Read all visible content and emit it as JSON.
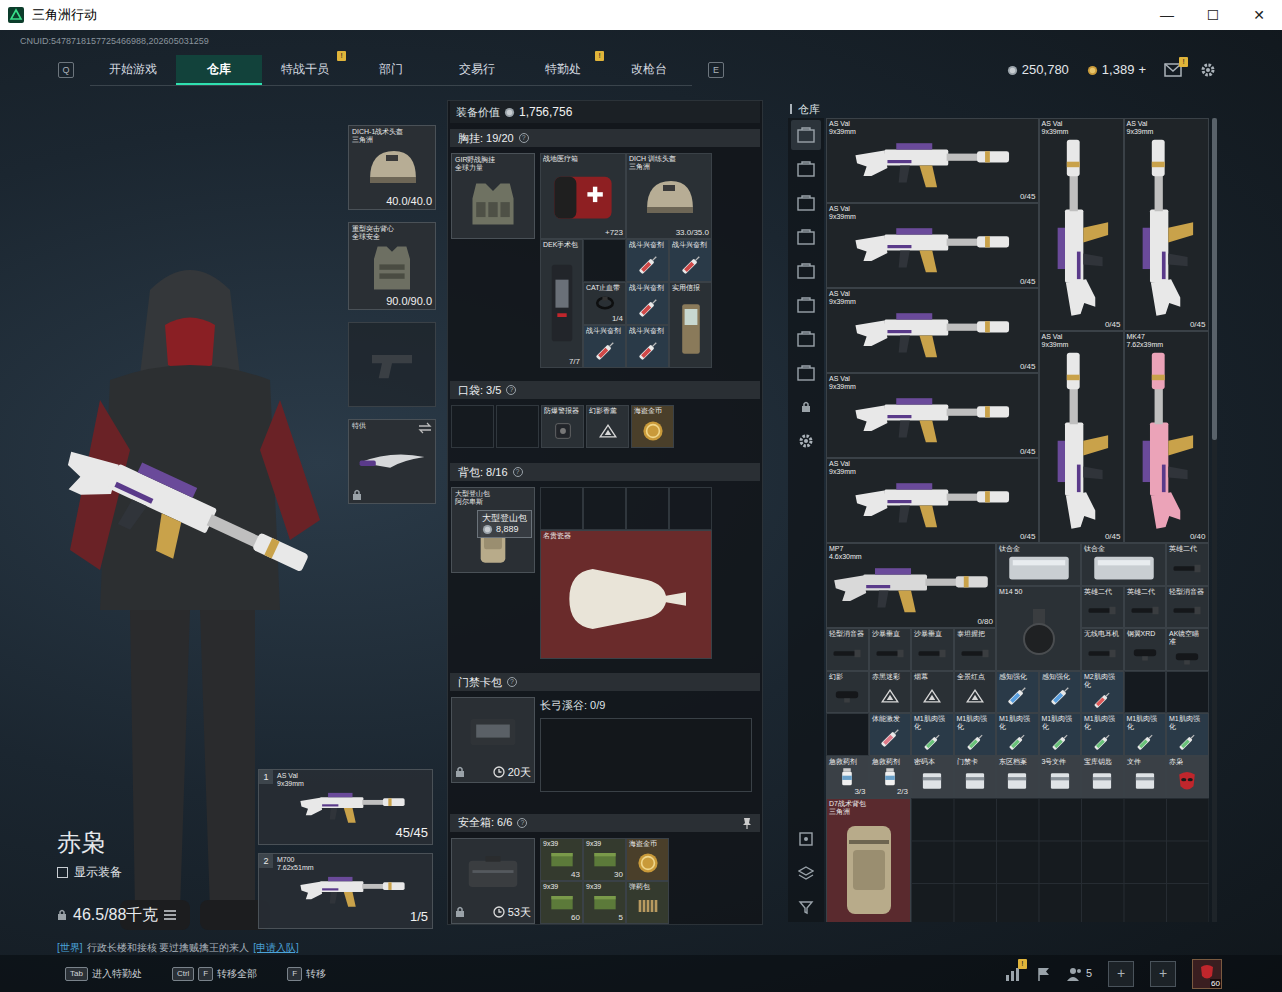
{
  "window": {
    "title": "三角洲行动",
    "controls": [
      "—",
      "☐",
      "✕"
    ]
  },
  "account": {
    "cnuid": "CNUID:5478718157725466988,202605031259"
  },
  "nav": {
    "prev_key": "Q",
    "next_key": "E",
    "tabs": [
      {
        "label": "开始游戏",
        "selected": false,
        "badge": ""
      },
      {
        "label": "仓库",
        "selected": true,
        "badge": ""
      },
      {
        "label": "特战干员",
        "selected": false,
        "badge": "!"
      },
      {
        "label": "部门",
        "selected": false,
        "badge": ""
      },
      {
        "label": "交易行",
        "selected": false,
        "badge": ""
      },
      {
        "label": "特勤处",
        "selected": false,
        "badge": "!"
      },
      {
        "label": "改枪台",
        "selected": false,
        "badge": ""
      }
    ]
  },
  "currency": {
    "silver": "250,780",
    "gold": "1,389",
    "add": "+",
    "mail_badge": "!"
  },
  "operator": {
    "name": "赤枭",
    "show_gear": {
      "label": "显示装备",
      "checked": false
    },
    "weight": "46.5/88千克",
    "chat": {
      "channel": "[世界]",
      "text": "行政长楼和接核 要过擒贼擒王的来人",
      "action": "[申请入队]"
    }
  },
  "equipment": {
    "helmet": {
      "name": "DICH-1战术头盔",
      "sub": "三角洲",
      "durability": "40.0/40.0"
    },
    "armor": {
      "name": "重型突击背心",
      "sub": "全球安全",
      "durability": "90.0/90.0"
    },
    "melee": {
      "name": "特供",
      "locked": true
    },
    "weapons": [
      {
        "slot": "1",
        "name": "AS Val",
        "caliber": "9x39mm",
        "ammo": "45/45"
      },
      {
        "slot": "2",
        "name": "M700",
        "caliber": "7.62x51mm",
        "ammo": "1/5"
      }
    ]
  },
  "loadout": {
    "value_label": "装备价值",
    "value": "1,756,756",
    "chest": {
      "title": "胸挂: 19/20",
      "help": "?",
      "rig": {
        "name": "GIR野战胸挂",
        "sub": "全球力量"
      },
      "items": [
        {
          "kind": "medkit",
          "label": "战地医疗箱",
          "count": "+723"
        },
        {
          "kind": "helmet",
          "label": "DICH 训练头盔",
          "sub": "三角洲",
          "count": "33.0/35.0"
        },
        {
          "kind": "surgery",
          "label": "DEK手术包",
          "count": "7/7"
        },
        {
          "kind": "empty"
        },
        {
          "kind": "syringe",
          "label": "战斗兴奋剂",
          "color": "#d04848"
        },
        {
          "kind": "syringe",
          "label": "战斗兴奋剂",
          "color": "#d04848"
        },
        {
          "kind": "tourniquet",
          "label": "CAT止血带",
          "count": "1/4"
        },
        {
          "kind": "syringe",
          "label": "战斗兴奋剂",
          "color": "#d04848"
        },
        {
          "kind": "device",
          "label": "实用信报"
        },
        {
          "kind": "syringe",
          "label": "战斗兴奋剂",
          "color": "#d04848"
        },
        {
          "kind": "syringe",
          "label": "战斗兴奋剂",
          "color": "#d04848"
        }
      ]
    },
    "pockets": {
      "title": "口袋: 3/5",
      "help": "?",
      "items": [
        {
          "kind": "empty"
        },
        {
          "kind": "empty"
        },
        {
          "kind": "gadget",
          "label": "防爆警报器"
        },
        {
          "kind": "triangle",
          "label": "幻影香薰"
        },
        {
          "kind": "coin",
          "label": "海盗金币"
        }
      ]
    },
    "backpack": {
      "title": "背包: 8/16",
      "help": "?",
      "bag": {
        "name": "大型登山包",
        "sub": "阿尔卑斯"
      },
      "tooltip": {
        "name": "大型登山包",
        "value": "8,889"
      },
      "items": [
        {
          "kind": "empty"
        },
        {
          "kind": "empty"
        },
        {
          "kind": "empty"
        },
        {
          "kind": "empty"
        },
        {
          "kind": "vase",
          "label": "名贵瓷器"
        }
      ]
    },
    "keycard": {
      "title": "门禁卡包",
      "help": "?",
      "timer": "20天",
      "map": "长弓溪谷: 0/9"
    },
    "safe": {
      "title": "安全箱: 6/6",
      "help": "?",
      "timer": "53天",
      "items": [
        {
          "kind": "ammo",
          "label": "9x39",
          "count": "43"
        },
        {
          "kind": "ammo",
          "label": "9x39",
          "count": "30"
        },
        {
          "kind": "coin",
          "label": "海盗金币"
        },
        {
          "kind": "ammo",
          "label": "9x39",
          "count": "60"
        },
        {
          "kind": "ammo",
          "label": "9x39",
          "count": "5"
        },
        {
          "kind": "shells",
          "label": "弹药包"
        }
      ]
    }
  },
  "warehouse": {
    "title": "仓库",
    "sidebar": [
      {
        "selected": true
      },
      {
        "selected": false
      },
      {
        "selected": false
      },
      {
        "selected": false
      },
      {
        "selected": false
      },
      {
        "selected": false
      },
      {
        "selected": false
      },
      {
        "selected": false
      }
    ],
    "scrollbar": {
      "level": 0.4
    },
    "items": [
      {
        "kind": "rifle-h",
        "label": "AS Val",
        "sub": "9x39mm",
        "count": "0/45",
        "color": "#e8e8e8"
      },
      {
        "kind": "rifle-v",
        "label": "AS Val",
        "sub": "9x39mm",
        "count": "0/45",
        "color": "#e8e8e8"
      },
      {
        "kind": "rifle-v",
        "label": "AS Val",
        "sub": "9x39mm",
        "count": "0/45",
        "color": "#e8e8e8"
      },
      {
        "kind": "rifle-h",
        "label": "AS Val",
        "sub": "9x39mm",
        "count": "0/45",
        "color": "#e8e8e8"
      },
      {
        "kind": "rifle-h",
        "label": "AS Val",
        "sub": "9x39mm",
        "count": "0/45",
        "color": "#e8e8e8"
      },
      {
        "kind": "rifle-v",
        "label": "AS Val",
        "sub": "9x39mm",
        "count": "0/45",
        "color": "#e8e8e8"
      },
      {
        "kind": "rifle-v",
        "label": "MK47",
        "sub": "7.62x39mm",
        "count": "0/40",
        "color": "#eba3b8"
      },
      {
        "kind": "rifle-h",
        "label": "AS Val",
        "sub": "9x39mm",
        "count": "0/45",
        "color": "#e8e8e8"
      },
      {
        "kind": "rifle-h",
        "label": "AS Val",
        "sub": "9x39mm",
        "count": "0/45",
        "color": "#e8e8e8"
      },
      {
        "kind": "smg",
        "label": "MP7",
        "sub": "4.6x30mm",
        "count": "0/80",
        "color": "#d9d9d9"
      },
      {
        "kind": "plate",
        "label": "钛合金"
      },
      {
        "kind": "plate",
        "label": "钛合金"
      },
      {
        "kind": "attachment",
        "label": "英雄二代"
      },
      {
        "kind": "drum",
        "label": "M14 50"
      },
      {
        "kind": "attachment",
        "label": "英雄二代"
      },
      {
        "kind": "attachment",
        "label": "英雄二代"
      },
      {
        "kind": "attachment",
        "label": "轻型消音器"
      },
      {
        "kind": "attachment",
        "label": "轻型消音器"
      },
      {
        "kind": "attachment",
        "label": "沙暴垂直"
      },
      {
        "kind": "attachment",
        "label": "沙暴垂直"
      },
      {
        "kind": "attachment",
        "label": "泰坦握把"
      },
      {
        "kind": "attachment",
        "label": "无线电耳机"
      },
      {
        "kind": "scope",
        "label": "钢翼XRD"
      },
      {
        "kind": "scope",
        "label": "AK镜空瞄准"
      },
      {
        "kind": "scope",
        "label": "幻影"
      },
      {
        "kind": "triangle",
        "label": "赤黑迷彩"
      },
      {
        "kind": "triangle",
        "label": "烟幕"
      },
      {
        "kind": "triangle",
        "label": "全景红点"
      },
      {
        "kind": "syringe",
        "label": "感知强化",
        "color": "#5aa0e0"
      },
      {
        "kind": "syringe",
        "label": "感知强化",
        "color": "#5aa0e0"
      },
      {
        "kind": "syringe",
        "label": "M2肌肉强化",
        "color": "#e05a5a"
      },
      {
        "kind": "empty"
      },
      {
        "kind": "empty"
      },
      {
        "kind": "empty"
      },
      {
        "kind": "syringe",
        "label": "体能激发",
        "color": "#e07a8a"
      },
      {
        "kind": "syringe",
        "label": "M1肌肉强化",
        "color": "#6ac27a"
      },
      {
        "kind": "syringe",
        "label": "M1肌肉强化",
        "color": "#6ac27a"
      },
      {
        "kind": "syringe",
        "label": "M1肌肉强化",
        "color": "#6ac27a"
      },
      {
        "kind": "syringe",
        "label": "M1肌肉强化",
        "color": "#6ac27a"
      },
      {
        "kind": "syringe",
        "label": "M1肌肉强化",
        "color": "#6ac27a"
      },
      {
        "kind": "syringe",
        "label": "M1肌肉强化",
        "color": "#6ac27a"
      },
      {
        "kind": "syringe",
        "label": "M1肌肉强化",
        "color": "#6ac27a"
      },
      {
        "kind": "pills",
        "label": "急救药剂",
        "count": "3/3"
      },
      {
        "kind": "pills",
        "label": "急救药剂",
        "count": "2/3"
      },
      {
        "kind": "card",
        "label": "密码本"
      },
      {
        "kind": "card",
        "label": "门禁卡"
      },
      {
        "kind": "card",
        "label": "东区档案"
      },
      {
        "kind": "card",
        "label": "3号文件"
      },
      {
        "kind": "card",
        "label": "宝库钥匙"
      },
      {
        "kind": "card",
        "label": "文件"
      },
      {
        "kind": "mask",
        "label": "赤枭"
      },
      {
        "kind": "backpack",
        "label": "D7战术背包",
        "sub": "三角洲"
      }
    ]
  },
  "bottom": {
    "hints": [
      {
        "keys": [
          "Tab"
        ],
        "label": "进入特勤处"
      },
      {
        "keys": [
          "Ctrl",
          "F"
        ],
        "label": "转移全部"
      },
      {
        "keys": [
          "F"
        ],
        "label": "转移"
      }
    ],
    "tray": {
      "stats_badge": "!",
      "squad": "5",
      "add": [
        "+",
        "+"
      ],
      "level": "60"
    }
  }
}
